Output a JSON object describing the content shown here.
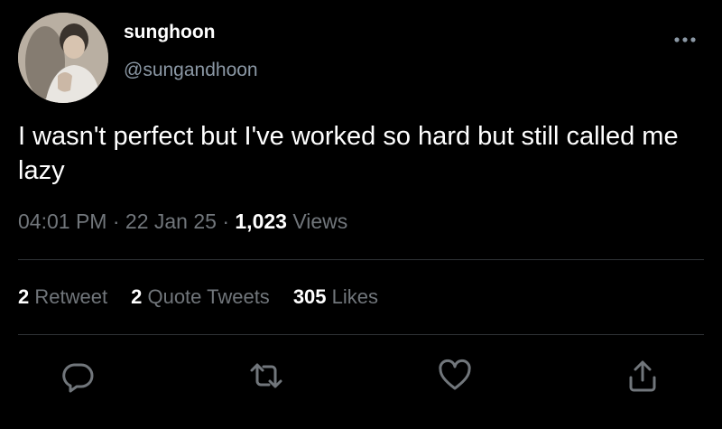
{
  "tweet": {
    "author": {
      "name": "sunghoon",
      "handle": "@sungandhoon"
    },
    "text": "I wasn't perfect but I've worked so hard but still called me lazy",
    "time": "04:01 PM",
    "separator": " · ",
    "date": "22 Jan 25",
    "views_count": "1,023",
    "views_label": "Views"
  },
  "stats": {
    "retweets_count": "2",
    "retweets_label": "Retweet",
    "quotes_count": "2",
    "quotes_label": "Quote Tweets",
    "likes_count": "305",
    "likes_label": "Likes"
  },
  "icons": {
    "more": "more-horizontal-icon",
    "reply": "reply-icon",
    "retweet": "retweet-icon",
    "like": "heart-icon",
    "share": "share-icon"
  },
  "colors": {
    "background": "#000000",
    "primary_text": "#ffffff",
    "secondary_text": "#71767b",
    "handle_text": "#8b98a5",
    "divider": "#2f3336",
    "icon": "#71767b"
  }
}
